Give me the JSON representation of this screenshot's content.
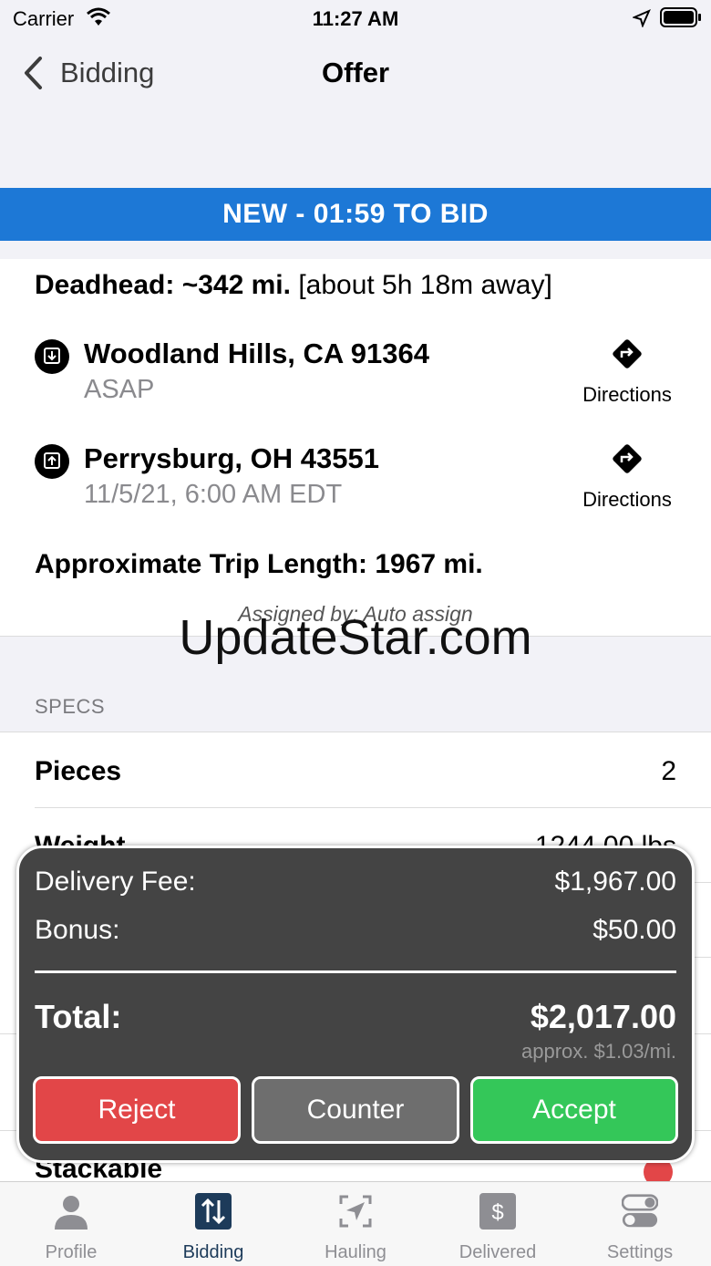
{
  "status_bar": {
    "carrier": "Carrier",
    "time": "11:27 AM"
  },
  "nav": {
    "back_label": "Bidding",
    "title": "Offer"
  },
  "banner": {
    "text": "NEW - 01:59 TO BID",
    "color": "#1d78d6"
  },
  "offer": {
    "deadhead_label": "Deadhead: ~342 mi.",
    "deadhead_detail": "[about 5h 18m away]",
    "stops": [
      {
        "city": "Woodland Hills, CA 91364",
        "time": "ASAP",
        "directions_label": "Directions",
        "icon": "pickup-icon"
      },
      {
        "city": "Perrysburg, OH 43551",
        "time": "11/5/21, 6:00 AM EDT",
        "directions_label": "Directions",
        "icon": "dropoff-icon"
      }
    ],
    "trip_length": "Approximate Trip Length: 1967 mi.",
    "assigned_by": "Assigned by: Auto assign"
  },
  "watermark": "UpdateStar.com",
  "specs": {
    "header": "SPECS",
    "rows": [
      {
        "label": "Pieces",
        "value": "2"
      },
      {
        "label": "Weight",
        "value": "1244.00 lbs"
      }
    ],
    "partial_row": {
      "label": "Stackable"
    }
  },
  "fee": {
    "delivery_label": "Delivery Fee:",
    "delivery_value": "$1,967.00",
    "bonus_label": "Bonus:",
    "bonus_value": "$50.00",
    "total_label": "Total:",
    "total_value": "$2,017.00",
    "approx": "approx. $1.03/mi."
  },
  "actions": {
    "reject": "Reject",
    "counter": "Counter",
    "accept": "Accept"
  },
  "colors": {
    "reject": "#e24648",
    "counter": "#6e6e6e",
    "accept": "#34c759",
    "active_tab": "#1d3b5a"
  },
  "tabs": [
    {
      "label": "Profile",
      "icon": "person-icon"
    },
    {
      "label": "Bidding",
      "icon": "bidding-icon",
      "active": true
    },
    {
      "label": "Hauling",
      "icon": "hauling-icon"
    },
    {
      "label": "Delivered",
      "icon": "dollar-icon"
    },
    {
      "label": "Settings",
      "icon": "toggle-icon"
    }
  ]
}
